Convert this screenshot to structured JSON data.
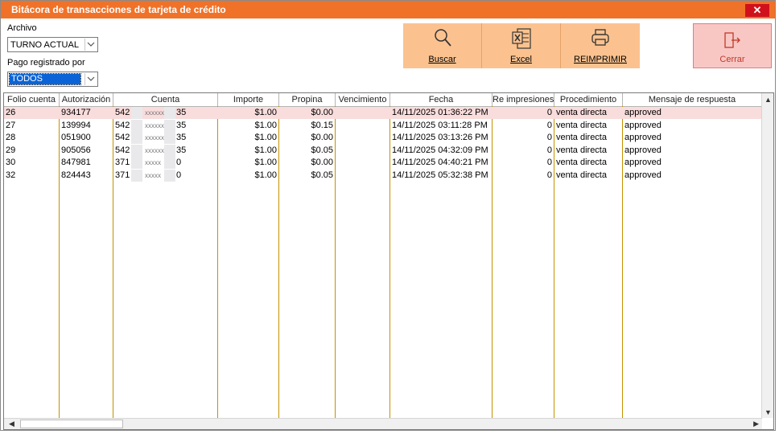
{
  "window": {
    "title": "Bitácora de transacciones de tarjeta de crédito",
    "close_glyph": "✕"
  },
  "filters": {
    "archivo_label": "Archivo",
    "archivo_value": "TURNO ACTUAL",
    "pago_label": "Pago registrado por",
    "pago_value": "TODOS"
  },
  "toolbar": {
    "buscar": "Buscar",
    "excel": "Excel",
    "reimprimir": "REIMPRIMIR",
    "cerrar": "Cerrar"
  },
  "table": {
    "columns": [
      "Folio cuenta",
      "Autorización",
      "Cuenta",
      "Importe",
      "Propina",
      "Vencimiento",
      "Fecha",
      "Re impresiones",
      "Procedimiento",
      "Mensaje de respuesta"
    ],
    "rows": [
      {
        "folio": "26",
        "autorizacion": "934177",
        "cuenta_pre": "542",
        "cuenta_mid": "xxxxxx",
        "cuenta_suf": "35",
        "importe": "$1.00",
        "propina": "$0.00",
        "vencimiento": "",
        "fecha": "14/11/2025 01:36:22 PM",
        "reimpresiones": "0",
        "procedimiento": "venta directa",
        "mensaje": "approved"
      },
      {
        "folio": "27",
        "autorizacion": "139994",
        "cuenta_pre": "542",
        "cuenta_mid": "xxxxxx",
        "cuenta_suf": "35",
        "importe": "$1.00",
        "propina": "$0.15",
        "vencimiento": "",
        "fecha": "14/11/2025 03:11:28 PM",
        "reimpresiones": "0",
        "procedimiento": "venta directa",
        "mensaje": "approved"
      },
      {
        "folio": "28",
        "autorizacion": "051900",
        "cuenta_pre": "542",
        "cuenta_mid": "xxxxxx",
        "cuenta_suf": "35",
        "importe": "$1.00",
        "propina": "$0.00",
        "vencimiento": "",
        "fecha": "14/11/2025 03:13:26 PM",
        "reimpresiones": "0",
        "procedimiento": "venta directa",
        "mensaje": "approved"
      },
      {
        "folio": "29",
        "autorizacion": "905056",
        "cuenta_pre": "542",
        "cuenta_mid": "xxxxxx",
        "cuenta_suf": "35",
        "importe": "$1.00",
        "propina": "$0.05",
        "vencimiento": "",
        "fecha": "14/11/2025 04:32:09 PM",
        "reimpresiones": "0",
        "procedimiento": "venta directa",
        "mensaje": "approved"
      },
      {
        "folio": "30",
        "autorizacion": "847981",
        "cuenta_pre": "371",
        "cuenta_mid": "xxxxx",
        "cuenta_suf": "0",
        "importe": "$1.00",
        "propina": "$0.00",
        "vencimiento": "",
        "fecha": "14/11/2025 04:40:21 PM",
        "reimpresiones": "0",
        "procedimiento": "venta directa",
        "mensaje": "approved"
      },
      {
        "folio": "32",
        "autorizacion": "824443",
        "cuenta_pre": "371",
        "cuenta_mid": "xxxxx",
        "cuenta_suf": "0",
        "importe": "$1.00",
        "propina": "$0.05",
        "vencimiento": "",
        "fecha": "14/11/2025 05:32:38 PM",
        "reimpresiones": "0",
        "procedimiento": "venta directa",
        "mensaje": "approved"
      }
    ]
  },
  "colors": {
    "title_bar": "#f07228",
    "toolbar_bg": "#fbc28f",
    "cerrar_bg": "#f8c7c4",
    "highlight_row": "#f9dcdc",
    "column_lines": "#c59100",
    "close_button": "#d0111b"
  },
  "icons": {
    "buscar": "search-icon",
    "excel": "excel-icon",
    "reimprimir": "printer-icon",
    "cerrar": "exit-door-icon",
    "dropdown": "chevron-down-icon"
  }
}
